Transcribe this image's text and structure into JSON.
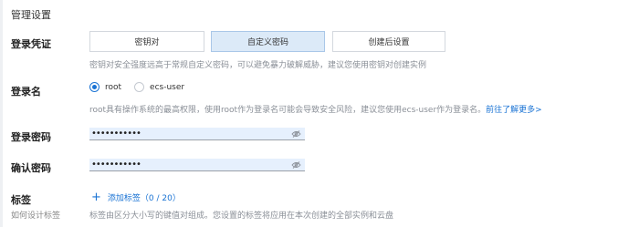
{
  "section": {
    "title": "管理设置"
  },
  "login_credential": {
    "label": "登录凭证",
    "options": [
      "密钥对",
      "自定义密码",
      "创建后设置"
    ],
    "selected": "自定义密码",
    "hint": "密钥对安全强度远高于常规自定义密码，可以避免暴力破解威胁，建议您使用密钥对创建实例"
  },
  "login_name": {
    "label": "登录名",
    "options": [
      "root",
      "ecs-user"
    ],
    "selected": "root",
    "hint": "root具有操作系统的最高权限，使用root作为登录名可能会导致安全风险，建议您使用ecs-user作为登录名。",
    "link": "前往了解更多>"
  },
  "login_password": {
    "label": "登录密码",
    "value": "•••••••••••"
  },
  "confirm_password": {
    "label": "确认密码",
    "value": "•••••••••••"
  },
  "tags": {
    "label": "标签",
    "sublabel": "如何设计标签",
    "add_label": "添加标签",
    "count": "（0 / 20）",
    "hint": "标签由区分大小写的键值对组成。您设置的标签将应用在本次创建的全部实例和云盘"
  },
  "icons": {
    "eye": "eye-slash-icon",
    "plus": "plus-icon"
  },
  "colors": {
    "accent": "#1a73d4",
    "active_bg": "#dceaf8",
    "input_bg": "#e6f0fd"
  }
}
